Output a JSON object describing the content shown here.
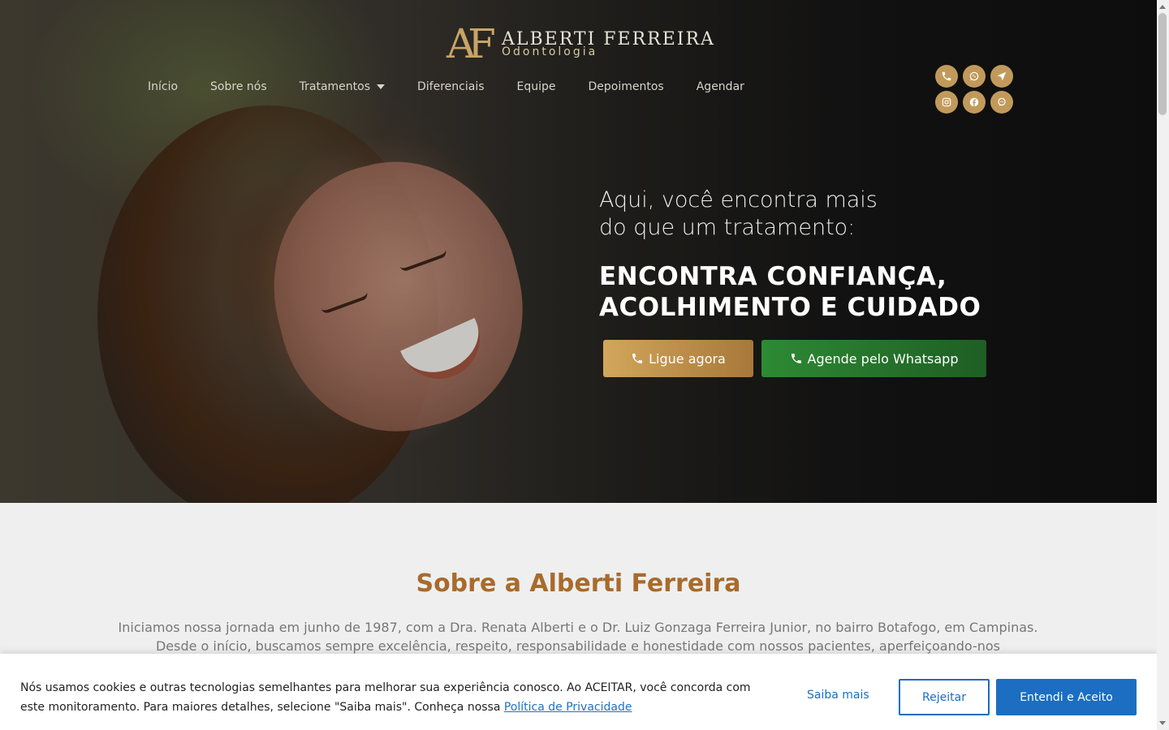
{
  "header": {
    "logo_mark": "AF",
    "logo_name": "ALBERTI FERREIRA",
    "logo_sub": "Odontologia",
    "nav": [
      "Início",
      "Sobre nós",
      "Tratamentos",
      "Diferenciais",
      "Equipe",
      "Depoimentos",
      "Agendar"
    ]
  },
  "socials": [
    "phone-icon",
    "whatsapp-icon",
    "location-icon",
    "instagram-icon",
    "facebook-icon",
    "chat-icon"
  ],
  "hero": {
    "intro_line1": "Aqui, você encontra mais",
    "intro_line2": "do que um tratamento:",
    "headline_line1": "ENCONTRA CONFIANÇA,",
    "headline_line2": "ACOLHIMENTO E CUIDADO",
    "btn_call": "Ligue agora",
    "btn_whatsapp": "Agende pelo Whatsapp"
  },
  "about": {
    "title": "Sobre a Alberti Ferreira",
    "text": "Iniciamos nossa jornada em junho de 1987, com a Dra. Renata Alberti e o Dr. Luiz Gonzaga Ferreira Junior, no bairro Botafogo, em Campinas. Desde o início, buscamos sempre excelência, respeito, responsabilidade e honestidade com nossos pacientes, aperfeiçoando-nos continuamente nas áreas em"
  },
  "cookie": {
    "text": "Nós usamos cookies e outras tecnologias semelhantes para melhorar sua experiência conosco. Ao ACEITAR, você concorda com este monitoramento. Para maiores detalhes, selecione \"Saiba mais\". Conheça nossa ",
    "link": "Política de Privacidade",
    "more": "Saiba mais",
    "reject": "Rejeitar",
    "accept": "Entendi e Aceito"
  },
  "colors": {
    "gold": "#c19a5b",
    "title_brown": "#a86b2c",
    "green": "#2d8a33",
    "cookie_blue": "#1b6ec2"
  }
}
